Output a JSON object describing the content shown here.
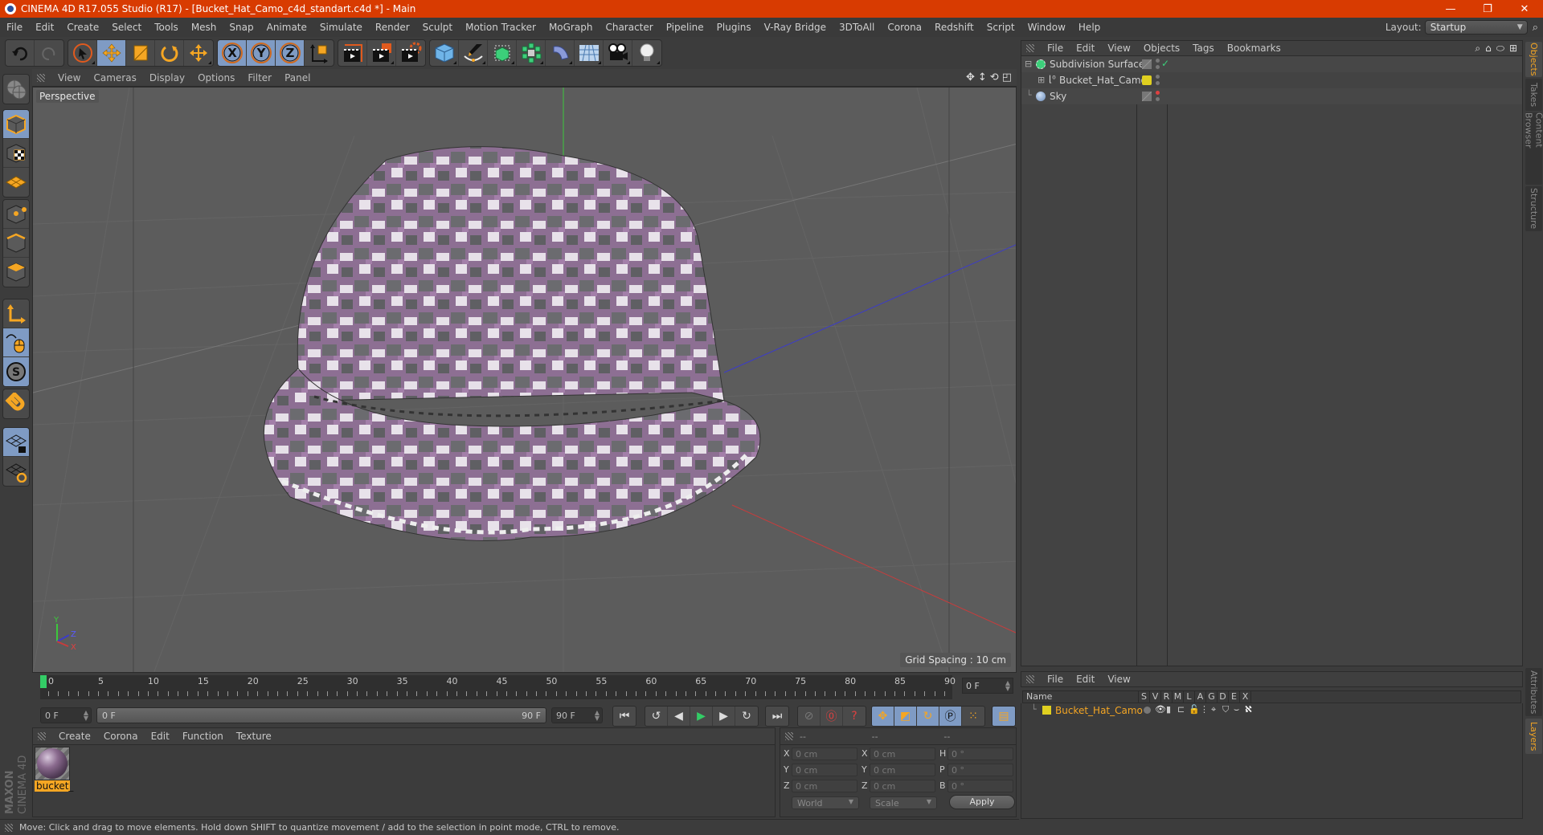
{
  "window": {
    "title": "CINEMA 4D R17.055 Studio (R17) - [Bucket_Hat_Camo_c4d_standart.c4d *] - Main",
    "controls": [
      "minimize",
      "restore",
      "close"
    ]
  },
  "menubar": {
    "items": [
      "File",
      "Edit",
      "Create",
      "Select",
      "Tools",
      "Mesh",
      "Snap",
      "Animate",
      "Simulate",
      "Render",
      "Sculpt",
      "Motion Tracker",
      "MoGraph",
      "Character",
      "Pipeline",
      "Plugins",
      "V-Ray Bridge",
      "3DToAll",
      "Corona",
      "Redshift",
      "Script",
      "Window",
      "Help"
    ],
    "layout_label": "Layout:",
    "layout_value": "Startup"
  },
  "toolbar": {
    "groups": [
      [
        {
          "icon": "undo-icon"
        },
        {
          "icon": "redo-icon"
        }
      ],
      [
        {
          "icon": "live-selection-icon"
        },
        {
          "icon": "move-icon",
          "active": true
        },
        {
          "icon": "scale-icon"
        },
        {
          "icon": "rotate-icon"
        },
        {
          "icon": "transform-icon"
        }
      ],
      [
        {
          "icon": "x-axis-lock-icon",
          "label": "X",
          "active": true
        },
        {
          "icon": "y-axis-lock-icon",
          "label": "Y",
          "active": true
        },
        {
          "icon": "z-axis-lock-icon",
          "label": "Z",
          "active": true
        },
        {
          "icon": "coordinate-system-icon"
        }
      ],
      [
        {
          "icon": "render-view-icon"
        },
        {
          "icon": "render-picture-viewer-icon"
        },
        {
          "icon": "render-settings-icon"
        }
      ],
      [
        {
          "icon": "cube-icon"
        },
        {
          "icon": "pen-spline-icon"
        },
        {
          "icon": "subdivision-surface-icon"
        },
        {
          "icon": "cloner-icon"
        },
        {
          "icon": "bend-deformer-icon"
        },
        {
          "icon": "floor-icon"
        },
        {
          "icon": "camera-icon"
        },
        {
          "icon": "light-icon"
        }
      ]
    ]
  },
  "lefttoolbar": {
    "items": [
      "make-editable-icon",
      "model-mode-icon",
      "texture-mode-icon",
      "workplane-mode-icon",
      "points-mode-icon",
      "edges-mode-icon",
      "polygons-mode-icon",
      "axis-mode-icon",
      "tweak-mode-icon",
      "snap-icon",
      "magnet-icon",
      "workplane-lock-icon",
      "workplane-align-icon"
    ]
  },
  "viewport": {
    "menu": [
      "View",
      "Cameras",
      "Display",
      "Options",
      "Filter",
      "Panel"
    ],
    "camera_label": "Perspective",
    "grid_spacing": "Grid Spacing : 10 cm",
    "axis_labels": {
      "x": "X",
      "y": "Y",
      "z": "Z"
    },
    "colors": {
      "x_axis": "#c83c3c",
      "y_axis": "#3cc83c",
      "z_axis": "#3c3cc8",
      "background": "#5c5c5c"
    }
  },
  "timeline": {
    "ticks": [
      "0",
      "5",
      "10",
      "15",
      "20",
      "25",
      "30",
      "35",
      "40",
      "45",
      "50",
      "55",
      "60",
      "65",
      "70",
      "75",
      "80",
      "85",
      "90"
    ],
    "current_frame": "0 F",
    "start_field": "0 F",
    "range_start": "0 F",
    "range_end": "90 F",
    "end_field": "90 F"
  },
  "playback": {
    "buttons": [
      "go-to-start-icon",
      "previous-key-icon",
      "previous-frame-icon",
      "play-icon",
      "next-frame-icon",
      "next-key-icon",
      "go-to-end-icon"
    ],
    "record": [
      "record-disabled-icon",
      "record-active-icon",
      "autokey-icon"
    ],
    "key_tracks": [
      "key-position-icon",
      "key-scale-icon",
      "key-rotation-icon",
      "key-parameter-icon",
      "key-pla-icon",
      "timeline-window-icon"
    ]
  },
  "material_manager": {
    "menu": [
      "Create",
      "Corona",
      "Edit",
      "Function",
      "Texture"
    ],
    "materials": [
      {
        "name": "bucket_"
      }
    ]
  },
  "coordinates": {
    "headers": [
      "--",
      "--",
      "--"
    ],
    "rows": [
      {
        "pos_label": "X",
        "pos": "0 cm",
        "size_label": "X",
        "size": "0 cm",
        "rot_label": "H",
        "rot": "0 °"
      },
      {
        "pos_label": "Y",
        "pos": "0 cm",
        "size_label": "Y",
        "size": "0 cm",
        "rot_label": "P",
        "rot": "0 °"
      },
      {
        "pos_label": "Z",
        "pos": "0 cm",
        "size_label": "Z",
        "size": "0 cm",
        "rot_label": "B",
        "rot": "0 °"
      }
    ],
    "space_select": "World",
    "mode_select": "Scale",
    "apply_label": "Apply"
  },
  "status": {
    "text": "Move: Click and drag to move elements. Hold down SHIFT to quantize movement / add to the selection in point mode, CTRL to remove."
  },
  "object_manager": {
    "menu": [
      "File",
      "Edit",
      "View",
      "Objects",
      "Tags",
      "Bookmarks"
    ],
    "objects": [
      {
        "name": "Subdivision Surface",
        "icon": "subdivision-surface-icon",
        "expand": "⊟",
        "tag": "gray",
        "vis_top": "#777",
        "vis_bottom": "#777",
        "check": "✓"
      },
      {
        "name": "Bucket_Hat_Camo",
        "icon": "null-object-icon",
        "expand": "⊞",
        "tag": "yellow",
        "vis_top": "#777",
        "vis_bottom": "#777",
        "check": ""
      },
      {
        "name": "Sky",
        "icon": "sky-icon",
        "expand": "",
        "tag": "gray",
        "vis_top": "#e04040",
        "vis_bottom": "#777",
        "check": ""
      }
    ]
  },
  "right_tabs": {
    "top": [
      {
        "label": "Objects",
        "active": true
      },
      {
        "label": "Takes"
      },
      {
        "label": "Content Browser"
      },
      {
        "label": "Structure"
      }
    ],
    "bottom": [
      {
        "label": "Attributes"
      },
      {
        "label": "Layers",
        "active": true
      }
    ]
  },
  "layer_manager": {
    "menu": [
      "File",
      "Edit",
      "View"
    ],
    "columns": [
      "Name",
      "S",
      "V",
      "R",
      "M",
      "L",
      "A",
      "G",
      "D",
      "E",
      "X"
    ],
    "layers": [
      {
        "name": "Bucket_Hat_Camo",
        "color": "#e0d020"
      }
    ]
  },
  "branding": {
    "maxon": "MAXON",
    "product": "CINEMA 4D"
  }
}
